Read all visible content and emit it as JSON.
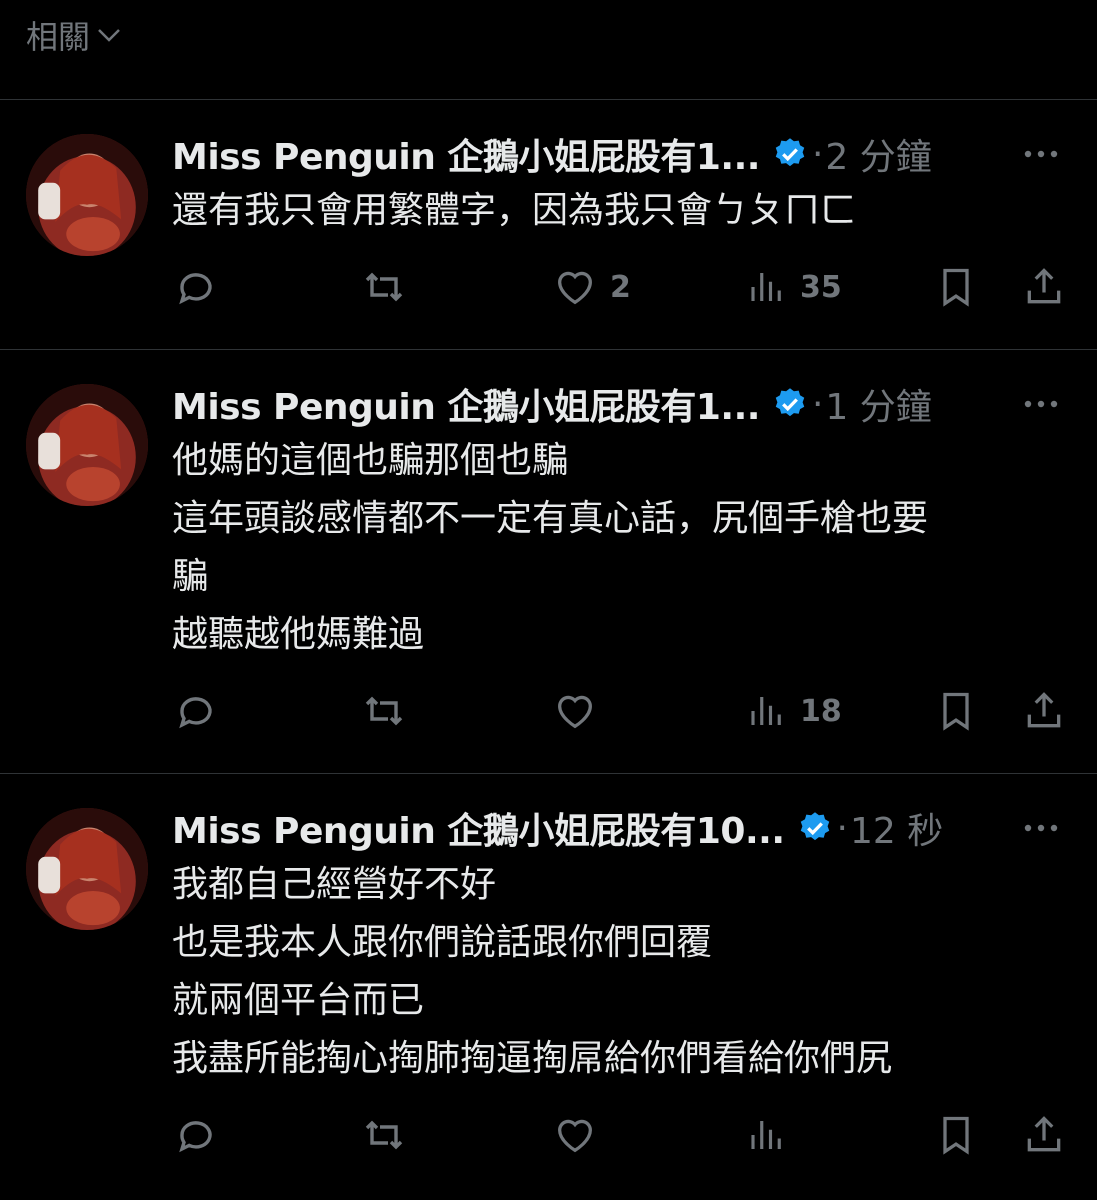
{
  "header": {
    "label": "相關"
  },
  "colors": {
    "background": "#000000",
    "text": "#e7e9ea",
    "muted": "#71767b",
    "divider": "#2f3336",
    "verified": "#1d9bf0"
  },
  "tweets": [
    {
      "name": "Miss Penguin 企鵝小姐屁股有1...",
      "separator": "·",
      "time": "2 分鐘",
      "lines": [
        "還有我只會用繁體字，因為我只會ㄅㄆㄇㄈ"
      ],
      "likes": "2",
      "views": "35"
    },
    {
      "name": "Miss Penguin 企鵝小姐屁股有1...",
      "separator": "·",
      "time": "1 分鐘",
      "lines": [
        "他媽的這個也騙那個也騙",
        "這年頭談感情都不一定有真心話，尻個手槍也要",
        "騙",
        "越聽越他媽難過"
      ],
      "likes": "",
      "views": "18"
    },
    {
      "name": "Miss Penguin 企鵝小姐屁股有10...",
      "separator": "·",
      "time": "12 秒",
      "lines": [
        "我都自己經營好不好",
        "也是我本人跟你們說話跟你們回覆",
        "就兩個平台而已",
        "我盡所能掏心掏肺掏逼掏屌給你們看給你們尻"
      ],
      "likes": "",
      "views": ""
    }
  ],
  "icons": [
    "chevron-down-icon",
    "verified-badge-icon",
    "more-icon",
    "reply-icon",
    "retweet-icon",
    "like-icon",
    "views-icon",
    "bookmark-icon",
    "share-icon"
  ]
}
